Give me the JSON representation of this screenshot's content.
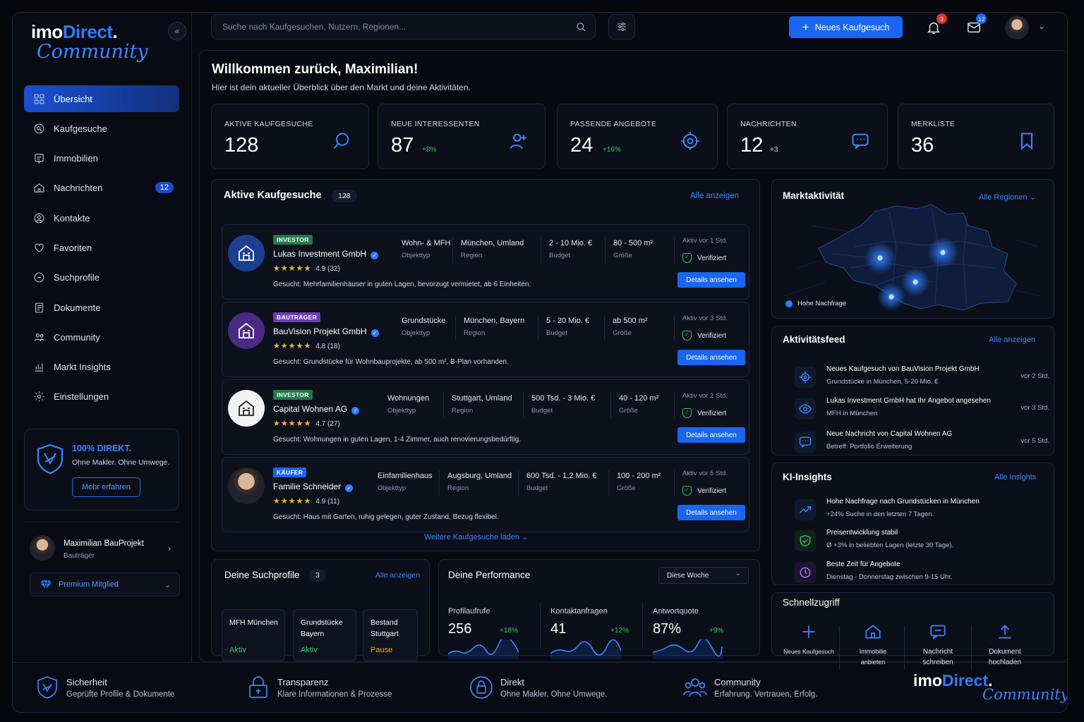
{
  "brand": {
    "name_a": "imo",
    "name_b": "Direct",
    "dot": ".",
    "script": "Community"
  },
  "sidebar": {
    "items": [
      {
        "label": "Übersicht",
        "icon": "grid-icon",
        "active": true
      },
      {
        "label": "Kaufgesuche",
        "icon": "search-doc-icon"
      },
      {
        "label": "Immobilien",
        "icon": "building-icon"
      },
      {
        "label": "Nachrichten",
        "icon": "home-icon",
        "badge": "12"
      },
      {
        "label": "Kontakte",
        "icon": "contacts-icon"
      },
      {
        "label": "Favoriten",
        "icon": "heart-icon"
      },
      {
        "label": "Suchprofile",
        "icon": "search-profile-icon"
      },
      {
        "label": "Dokumente",
        "icon": "document-icon"
      },
      {
        "label": "Community",
        "icon": "community-icon"
      },
      {
        "label": "Markt Insights",
        "icon": "chart-icon"
      },
      {
        "label": "Einstellungen",
        "icon": "gear-icon"
      }
    ],
    "promo": {
      "title": "100% DIREKT.",
      "subtitle": "Ohne Makler. Ohne Umwege.",
      "button": "Mehr erfahren"
    },
    "user": {
      "name": "Maximilian BauProjekt",
      "role": "Bauträger"
    },
    "premium": "Premium Mitglied"
  },
  "topbar": {
    "search_placeholder": "Suche nach Kaufgesuchen, Nutzern, Regionen...",
    "new_button": "Neues Kaufgesuch",
    "notif_count": "3",
    "mail_count": "12"
  },
  "welcome": {
    "title": "Willkommen zurück, Maximilian!",
    "subtitle": "Hier ist dein aktueller Überblick über den Markt und deine Aktivitäten."
  },
  "stats": [
    {
      "label": "AKTIVE KAUFGESUCHE",
      "value": "128",
      "delta": ""
    },
    {
      "label": "NEUE INTERESSENTEN",
      "value": "87",
      "delta": "+8%"
    },
    {
      "label": "PASSENDE ANGEBOTE",
      "value": "24",
      "delta": "+16%"
    },
    {
      "label": "NACHRICHTEN",
      "value": "12",
      "delta": "+3"
    },
    {
      "label": "MERKLISTE",
      "value": "36",
      "delta": ""
    }
  ],
  "requests": {
    "title": "Aktive Kaufgesuche",
    "count": "128",
    "link": "Alle anzeigen",
    "more": "Weitere Kaufgesuche laden",
    "label_type": "Objekttyp",
    "label_region": "Region",
    "label_budget": "Budget",
    "label_size": "Größe",
    "verified": "Verifiziert",
    "details": "Details ansehen",
    "items": [
      {
        "tag": "INVESTOR",
        "tag_color": "#1f7a4d",
        "name": "Lukas Investment GmbH",
        "stars": "★★★★★",
        "rating": "4.9 (32)",
        "type": "Wohn- & MFH",
        "region": "München, Umland",
        "budget": "2 - 10 Mio. €",
        "size": "80 - 500 m²",
        "active": "Aktiv vor 1 Std.",
        "desc": "Gesucht: Mehrfamilienhäuser in guten Lagen, bevorzugt vermietet, ab 6 Einheiten.",
        "logo": "#1d3f8f"
      },
      {
        "tag": "BAUTRÄGER",
        "tag_color": "#6b3fb3",
        "name": "BauVision Projekt GmbH",
        "stars": "★★★★★",
        "rating": "4.8 (18)",
        "type": "Grundstücke",
        "region": "München, Bayern",
        "budget": "5 - 20 Mio. €",
        "size": "ab 500 m²",
        "active": "Aktiv vor 3 Std.",
        "desc": "Gesucht: Grundstücke für Wohnbauprojekte, ab 500 m², B-Plan vorhanden.",
        "logo": "#4a2a84"
      },
      {
        "tag": "INVESTOR",
        "tag_color": "#1f7a4d",
        "name": "Capital Wohnen AG",
        "stars": "★★★★★",
        "rating": "4.7 (27)",
        "type": "Wohnungen",
        "region": "Stuttgart, Umland",
        "budget": "500 Tsd. - 3 Mio. €",
        "size": "40 - 120 m²",
        "active": "Aktiv vor 2 Std.",
        "desc": "Gesucht: Wohnungen in guten Lagen, 1-4 Zimmer, auch renovierungsbedürftig.",
        "logo": "#f2f2f2"
      },
      {
        "tag": "KÄUFER",
        "tag_color": "#1a66f0",
        "name": "Familie Schneider",
        "stars": "★★★★★",
        "rating": "4.9 (11)",
        "type": "Einfamilienhaus",
        "region": "Augsburg, Umland",
        "budget": "600 Tsd. - 1,2 Mio. €",
        "size": "100 - 200 m²",
        "active": "Aktiv vor 5 Std.",
        "desc": "Gesucht: Haus mit Garten, ruhig gelegen, guter Zustand, Bezug flexibel.",
        "logo": "photo"
      }
    ]
  },
  "market": {
    "title": "Marktaktivität",
    "filter": "Alle Regionen",
    "legend": "Hohe Nachfrage"
  },
  "feed": {
    "title": "Aktivitätsfeed",
    "link": "Alle anzeigen",
    "items": [
      {
        "title": "Neues Kaufgesuch von BauVision Projekt GmbH",
        "sub": "Grundstücke in München, 5-20 Mio. €",
        "time": "vor 2 Std."
      },
      {
        "title": "Lukas Investment GmbH hat Ihr Angebot angesehen",
        "sub": "MFH in München",
        "time": "vor 3 Std."
      },
      {
        "title": "Neue Nachricht von Capital Wohnen AG",
        "sub": "Betreff: Portfolio Erweiterung",
        "time": "vor 5 Std."
      }
    ]
  },
  "insights": {
    "title": "KI-Insights",
    "link": "Alle Insights",
    "items": [
      {
        "title": "Hohe Nachfrage nach Grundstücken in München",
        "sub": "+24% Suche in den letzten 7 Tagen."
      },
      {
        "title": "Preisentwicklung stabil",
        "sub": "Ø +3% in beliebten Lagen (letzte 30 Tage)."
      },
      {
        "title": "Beste Zeit für Angebote",
        "sub": "Dienstag - Donnerstag zwischen 9-15 Uhr."
      }
    ]
  },
  "profiles": {
    "title": "Deine Suchprofile",
    "count": "3",
    "link": "Alle anzeigen",
    "items": [
      {
        "name": "MFH München",
        "status": "Aktiv",
        "color": "#37c46a"
      },
      {
        "name": "Grundstücke Bayern",
        "status": "Aktiv",
        "color": "#37c46a"
      },
      {
        "name": "Bestand Stuttgart",
        "status": "Pause",
        "color": "#f5a623"
      }
    ]
  },
  "performance": {
    "title": "Deine Performance",
    "period": "Diese Woche",
    "items": [
      {
        "label": "Profilaufrufe",
        "value": "256",
        "delta": "+18%"
      },
      {
        "label": "Kontaktanfragen",
        "value": "41",
        "delta": "+12%"
      },
      {
        "label": "Antwortquote",
        "value": "87%",
        "delta": "+9%"
      }
    ]
  },
  "quick": {
    "title": "Schnellzugriff",
    "items": [
      {
        "label": "Neues Kaufgesuch",
        "icon": "plus-icon"
      },
      {
        "label": "Immobilie anbieten",
        "icon": "house-icon"
      },
      {
        "label": "Nachricht schreiben",
        "icon": "message-icon"
      },
      {
        "label": "Dokument hochladen",
        "icon": "upload-icon"
      }
    ]
  },
  "footer": {
    "items": [
      {
        "title": "Sicherheit",
        "sub": "Geprüfte Profile & Dokumente"
      },
      {
        "title": "Transparenz",
        "sub": "Klare Informationen & Prozesse"
      },
      {
        "title": "Direkt",
        "sub": "Ohne Makler. Ohne Umwege."
      },
      {
        "title": "Community",
        "sub": "Erfahrung. Vertrauen. Erfolg."
      }
    ]
  }
}
